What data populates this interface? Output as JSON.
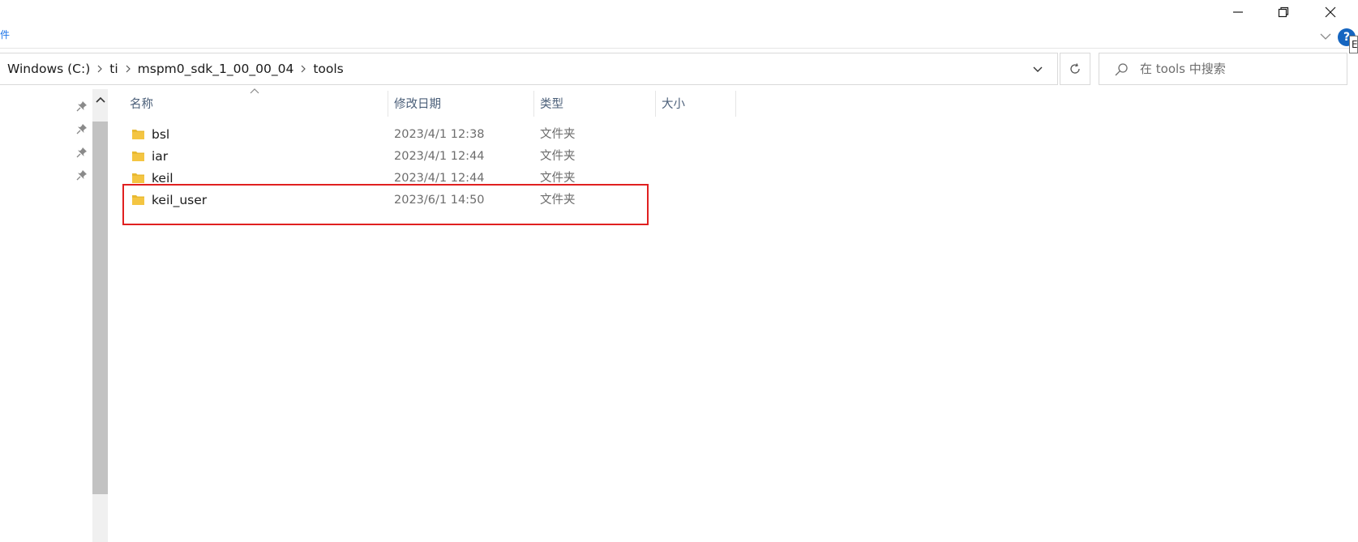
{
  "window": {
    "icons": {
      "minimize": "minimize-icon",
      "maximize": "restore-icon",
      "close": "close-icon"
    }
  },
  "ribbon": {
    "edge_glyph": "件",
    "help_symbol": "?",
    "tooltip_glyph": "E"
  },
  "address": {
    "breadcrumbs": [
      "Windows (C:)",
      "ti",
      "mspm0_sdk_1_00_00_04",
      "tools"
    ]
  },
  "search": {
    "placeholder": "在 tools 中搜索"
  },
  "columns": {
    "name": "名称",
    "modified": "修改日期",
    "type": "类型",
    "size": "大小"
  },
  "files": [
    {
      "name": "bsl",
      "modified": "2023/4/1 12:38",
      "type": "文件夹"
    },
    {
      "name": "iar",
      "modified": "2023/4/1 12:44",
      "type": "文件夹"
    },
    {
      "name": "keil",
      "modified": "2023/4/1 12:44",
      "type": "文件夹"
    },
    {
      "name": "keil_user",
      "modified": "2023/6/1 14:50",
      "type": "文件夹"
    }
  ],
  "colors": {
    "highlight": "#e02020",
    "folder": "#f4c542",
    "help": "#1565c0"
  }
}
